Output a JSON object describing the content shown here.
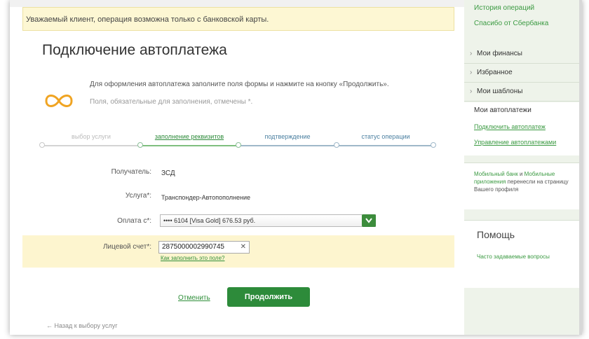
{
  "alert": {
    "text": "Уважаемый клиент, операция возможна только с банковской карты."
  },
  "page": {
    "title": "Подключение автоплатежа",
    "intro_text": "Для оформления автоплатежа заполните поля формы и нажмите на кнопку «Продолжить».",
    "intro_note": "Поля, обязательные для заполнения, отмечены *."
  },
  "steps": [
    {
      "label": "выбор услуги",
      "state": "done"
    },
    {
      "label": "заполнение реквизитов",
      "state": "active"
    },
    {
      "label": "подтверждение",
      "state": "pending"
    },
    {
      "label": "статус операции",
      "state": "pending"
    }
  ],
  "form": {
    "recipient_label": "Получатель:",
    "recipient_value": "ЗСД",
    "service_label": "Услуга*:",
    "service_value": "Транспондер-Автопополнение",
    "payment_label": "Оплата с*:",
    "payment_value": "•••• 6104 [Visa Gold] 676.53 руб.",
    "account_label": "Лицевой счет*:",
    "account_value": "2875000002990745",
    "account_help": "Как заполнить это поле?"
  },
  "actions": {
    "cancel_label": "Отменить",
    "continue_label": "Продолжить",
    "back_label": "← Назад к выбору услуг"
  },
  "sidebar": {
    "top_link1": "История операций",
    "top_link2": "Спасибо от Сбербанка",
    "menu": [
      "Мои финансы",
      "Избранное",
      "Мои шаблоны"
    ],
    "autopay_header": "Мои автоплатежи",
    "autopay_connect": "Подключить автоплатеж",
    "autopay_manage": "Управление автоплатежами",
    "mobile_part1": "Мобильный банк",
    "mobile_and": " и ",
    "mobile_part2": "Мобильные приложения",
    "mobile_part3": " перенесли на страницу Вашего профиля",
    "help_title": "Помощь",
    "help_faq": "Часто задаваемые вопросы"
  },
  "colors": {
    "accent_green": "#2d8b3a",
    "alert_bg": "#fdf7d3",
    "sidebar_bg": "#eef3ea",
    "icon_orange": "#f0a422"
  }
}
